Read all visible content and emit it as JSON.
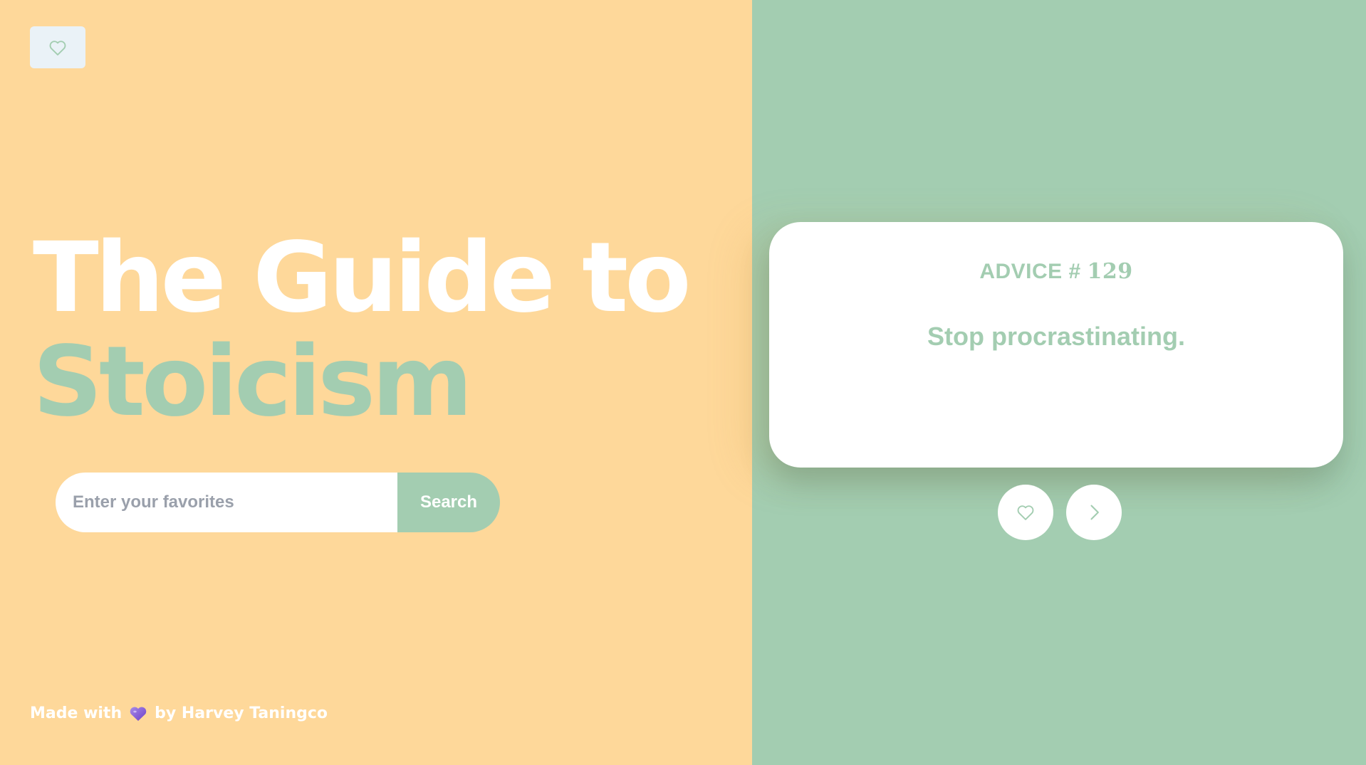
{
  "hero": {
    "title_line1": "The Guide to",
    "title_line2": "Stoicism"
  },
  "search": {
    "placeholder": "Enter your favorites",
    "value": "",
    "button_label": "Search"
  },
  "advice": {
    "label": "ADVICE # ",
    "number": "129",
    "text": "Stop procrastinating."
  },
  "footer": {
    "prefix": "Made with",
    "suffix": "by Harvey Taningco"
  },
  "icons": {
    "favorites_toggle": "heart-outline-icon",
    "like": "heart-outline-icon",
    "next": "chevron-right-icon",
    "footer_heart": "purple-heart-emoji"
  },
  "colors": {
    "left_bg": "#fed89a",
    "right_bg": "#a3cdb1",
    "accent": "#a3cdb1",
    "card_bg": "#ffffff"
  }
}
